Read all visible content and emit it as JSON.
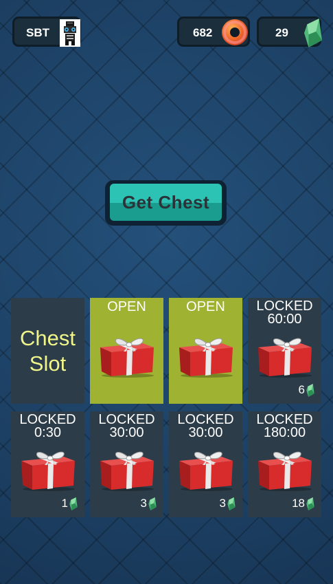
{
  "topbar": {
    "player_name": "SBT",
    "coins": "682",
    "gems": "29"
  },
  "get_chest": {
    "label": "Get Chest"
  },
  "chest_slot_label": [
    "Chest",
    "Slot"
  ],
  "slots": [
    {
      "status": "OPEN",
      "timer": "",
      "price": ""
    },
    {
      "status": "OPEN",
      "timer": "",
      "price": ""
    },
    {
      "status": "LOCKED",
      "timer": "60:00",
      "price": "6"
    },
    {
      "status": "LOCKED",
      "timer": "0:30",
      "price": "1"
    },
    {
      "status": "LOCKED",
      "timer": "30:00",
      "price": "3"
    },
    {
      "status": "LOCKED",
      "timer": "30:00",
      "price": "3"
    },
    {
      "status": "LOCKED",
      "timer": "180:00",
      "price": "18"
    }
  ],
  "colors": {
    "background": "#1f4467",
    "open_slot": "#9fb232",
    "locked_slot": "#2c3c48",
    "button": "#2dc3b4",
    "slot_label": "#f0f58a"
  },
  "icons": [
    "player-avatar-icon",
    "donut-coin-icon",
    "gem-icon",
    "gift-box-icon"
  ]
}
